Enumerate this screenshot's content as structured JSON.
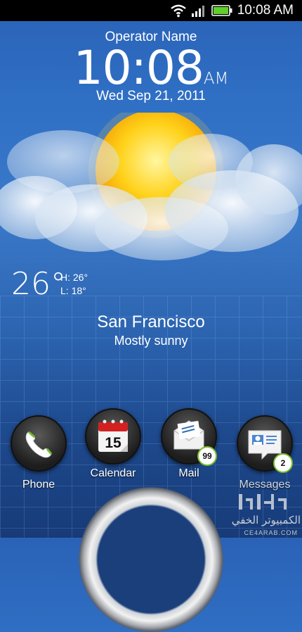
{
  "status_bar": {
    "time": "10:08 AM",
    "icons": [
      "wifi-icon",
      "signal-icon",
      "battery-icon"
    ]
  },
  "lockscreen": {
    "operator": "Operator Name",
    "clock": {
      "time": "10:08",
      "ampm": "AM"
    },
    "date": "Wed Sep 21, 2011"
  },
  "weather": {
    "temp": "26°",
    "high": "H: 26°",
    "low": "L: 18°",
    "city": "San Francisco",
    "condition": "Mostly sunny",
    "icon": "sun-behind-cloud-icon"
  },
  "dock": [
    {
      "label": "Phone",
      "icon": "phone-icon",
      "badge": ""
    },
    {
      "label": "Calendar",
      "icon": "calendar-icon",
      "day": "15",
      "badge": ""
    },
    {
      "label": "Mail",
      "icon": "mail-icon",
      "badge": "99"
    },
    {
      "label": "Messages",
      "icon": "messages-icon",
      "badge": "2"
    }
  ],
  "watermark": {
    "arabic": "الكمبيوتر الخفي",
    "site": "CE4ARAB.COM"
  },
  "colors": {
    "sky_top": "#2a62b6",
    "sky_bottom": "#173b78",
    "badge_ring": "#7bbd2b"
  }
}
